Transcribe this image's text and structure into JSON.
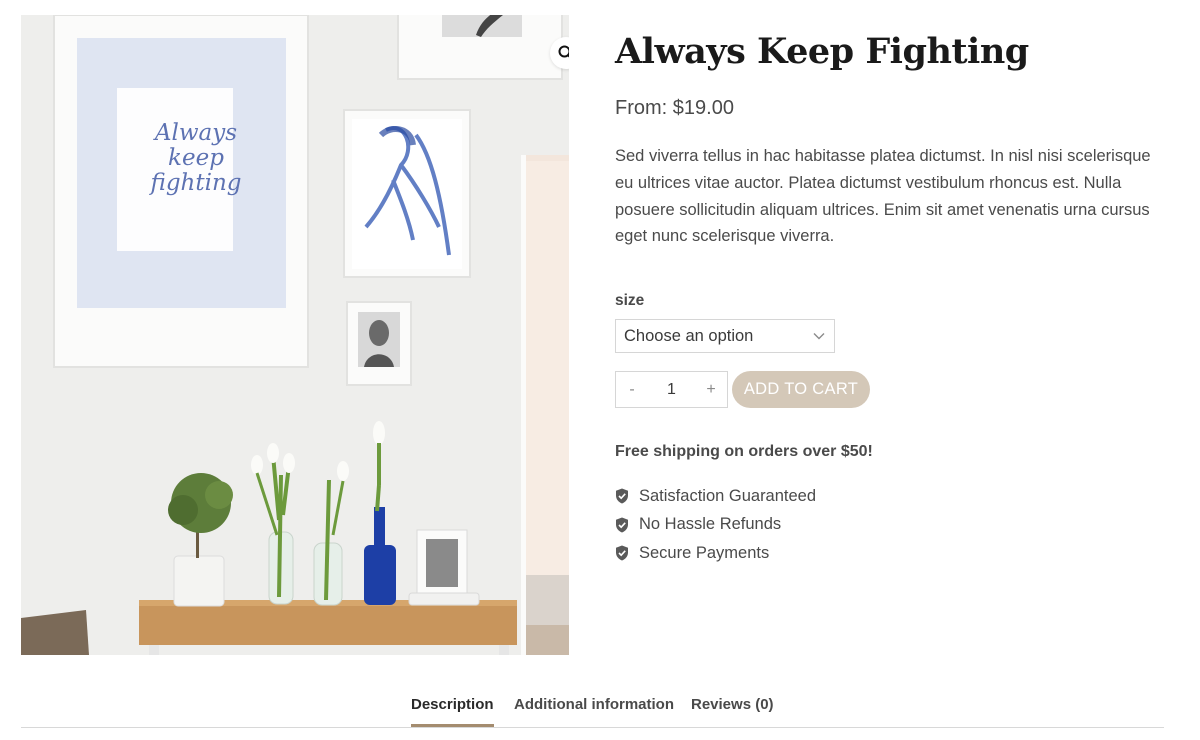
{
  "product": {
    "title": "Always Keep Fighting",
    "price": "From: $19.00",
    "description": "Sed viverra tellus in hac habitasse platea dictumst. In nisl nisi scelerisque eu ultrices vitae auctor. Platea dictumst vestibulum rhoncus est. Nulla posuere sollicitudin aliquam ultrices. Enim sit amet venenatis urna cursus eget nunc scelerisque viverra.",
    "poster_text": "Always\nkeep\nfighting"
  },
  "variation": {
    "label": "size",
    "selected": "Choose an option"
  },
  "cart": {
    "minus": "-",
    "quantity": "1",
    "plus": "+",
    "add_label": "ADD TO CART",
    "button_color": "#d4c8b8"
  },
  "shipping_note": "Free shipping on orders over $50!",
  "benefits": [
    "Satisfaction Guaranteed",
    "No Hassle Refunds",
    "Secure Payments"
  ],
  "tabs": [
    "Description",
    "Additional information",
    "Reviews (0)"
  ],
  "active_tab": "Description",
  "icons": {
    "zoom": "search-icon",
    "select": "chevron-down-icon",
    "benefit": "shield-check-icon"
  },
  "colors": {
    "accent": "#a48c6f",
    "poster_blue": "#5d72b2"
  }
}
